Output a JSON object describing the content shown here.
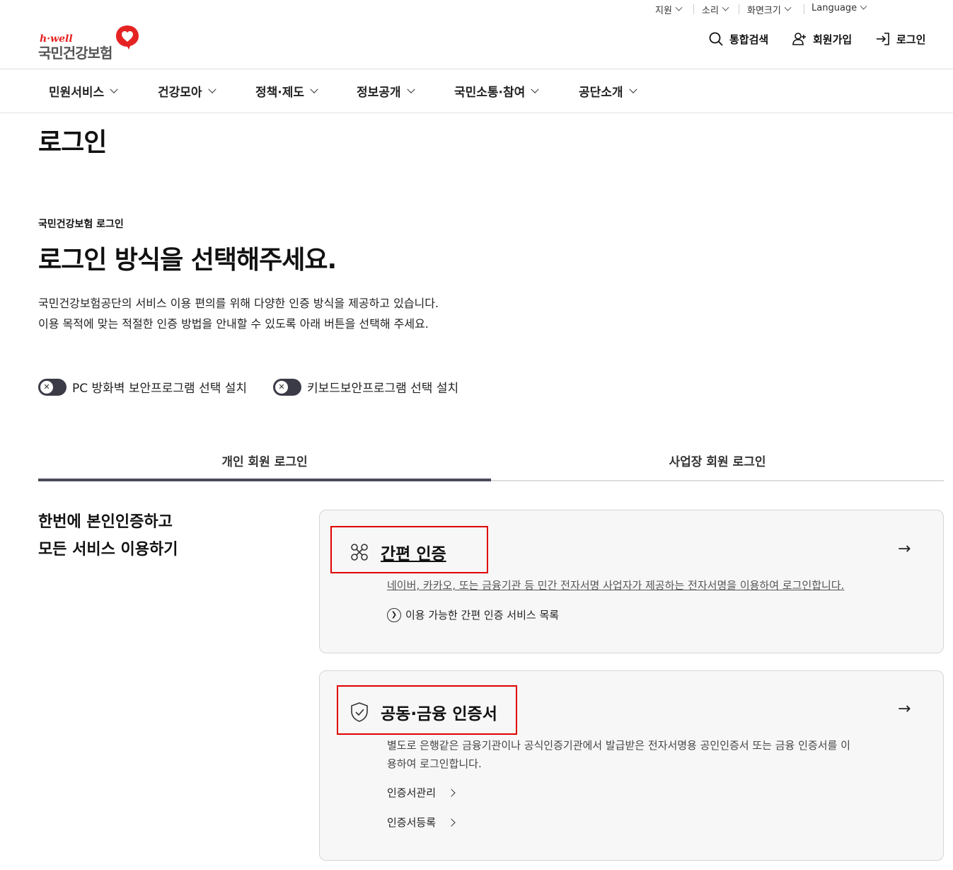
{
  "util": {
    "support": "지원",
    "sound": "소리",
    "screen_size": "화면크기",
    "language": "Language"
  },
  "logo": {
    "hwell": "h·well",
    "name": "국민건강보험"
  },
  "header": {
    "search": "통합검색",
    "signup": "회원가입",
    "login": "로그인"
  },
  "gnb": [
    "민원서비스",
    "건강모아",
    "정책·제도",
    "정보공개",
    "국민소통·참여",
    "공단소개"
  ],
  "page_title": "로그인",
  "section": {
    "label": "국민건강보험 로그인",
    "heading": "로그인 방식을 선택해주세요.",
    "desc_line1": "국민건강보험공단의 서비스 이용 편의를 위해 다양한 인증 방식을 제공하고 있습니다.",
    "desc_line2": "이용 목적에 맞는 적절한 인증 방법을 안내할 수 있도록 아래 버튼을 선택해 주세요."
  },
  "toggles": {
    "firewall": "PC 방화벽 보안프로그램 선택 설치",
    "keyboard": "키보드보안프로그램 선택 설치"
  },
  "tabs": {
    "personal": "개인 회원 로그인",
    "business": "사업장 회원 로그인"
  },
  "side": {
    "line1": "한번에 본인인증하고",
    "line2": "모든 서비스 이용하기"
  },
  "simple_auth": {
    "title": "간편 인증",
    "desc": "네이버, 카카오, 또는 금융기관 등 민간 전자서명 사업자가 제공하는 전자서명을 이용하여 로그인합니다.",
    "link": "이용 가능한 간편 인증 서비스 목록"
  },
  "cert_auth": {
    "title": "공동·금융 인증서",
    "desc_line1": "별도로 은행같은 금융기관이나 공식인증기관에서 발급받은 전자서명용 공인인증서 또는 금융 인증서를 이",
    "desc_line2": "용하여 로그인합니다.",
    "manage": "인증서관리",
    "register": "인증서등록"
  },
  "colors": {
    "brand_red": "#e52323",
    "highlight_red": "#e00000",
    "tab_active": "#4a4a5c"
  }
}
